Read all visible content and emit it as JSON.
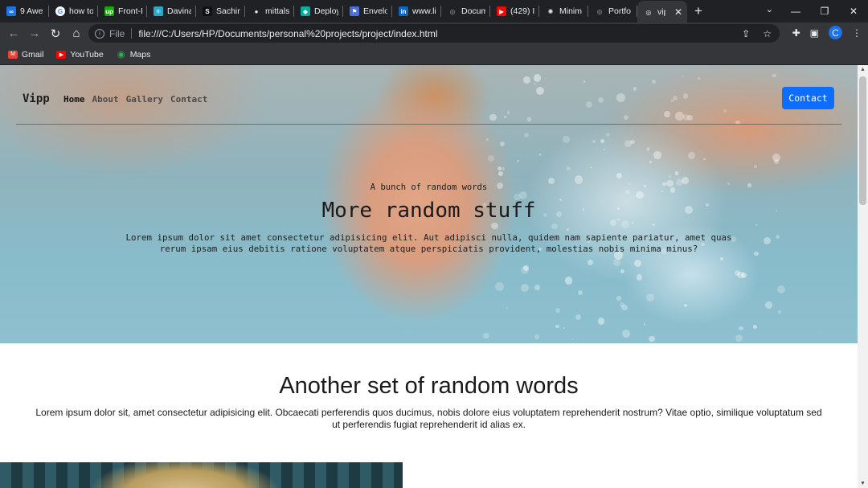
{
  "browser": {
    "tabs": [
      {
        "label": "9 Awe",
        "icon": "infinity-icon",
        "color": "#1a73e8",
        "glyph": "∞"
      },
      {
        "label": "how to",
        "icon": "google-icon",
        "color": "#ffffff",
        "glyph": "G"
      },
      {
        "label": "Front-I",
        "icon": "upwork-icon",
        "color": "#14a800",
        "glyph": "up"
      },
      {
        "label": "Davina",
        "icon": "react-icon",
        "color": "#2aa8c9",
        "glyph": "⚛"
      },
      {
        "label": "Sachin",
        "icon": "notion-icon",
        "color": "#111111",
        "glyph": "S"
      },
      {
        "label": "mittals",
        "icon": "github-icon",
        "color": "#e8eaed",
        "glyph": "●"
      },
      {
        "label": "Deploy",
        "icon": "diamond-icon",
        "color": "#00ad9f",
        "glyph": "◆"
      },
      {
        "label": "Envelo",
        "icon": "flag-icon",
        "color": "#4a6ee0",
        "glyph": "⚑"
      },
      {
        "label": "www.li",
        "icon": "linkedin-icon",
        "color": "#0a66c2",
        "glyph": "in"
      },
      {
        "label": "Docum",
        "icon": "globe-icon",
        "color": "#9aa0a6",
        "glyph": "◎"
      },
      {
        "label": "(429) I",
        "icon": "youtube-icon",
        "color": "#ff0000",
        "glyph": "▶"
      },
      {
        "label": "Minim",
        "icon": "openai-icon",
        "color": "#e8eaed",
        "glyph": "✺"
      },
      {
        "label": "Portfo",
        "icon": "globe-icon",
        "color": "#9aa0a6",
        "glyph": "◎"
      }
    ],
    "active_tab": {
      "label": "vip",
      "icon": "globe-icon",
      "close": "✕"
    },
    "new_tab": "+",
    "tab_search": "⌄",
    "window": {
      "minimize": "—",
      "restore": "❐",
      "close": "✕"
    },
    "toolbar": {
      "back": "←",
      "forward": "→",
      "reload": "↻",
      "home": "⌂",
      "info": "i",
      "scheme_label": "File",
      "url": "file:///C:/Users/HP/Documents/personal%20projects/project/index.html",
      "share": "⇪",
      "bookmark_star": "☆",
      "extensions": "✚",
      "sidepanel": "▣",
      "profile_initial": "C",
      "menu": "⋮"
    },
    "bookmarks": [
      {
        "label": "Gmail",
        "icon": "gmail-icon",
        "color": "#ea4335",
        "glyph": "M"
      },
      {
        "label": "YouTube",
        "icon": "youtube-icon",
        "color": "#ff0000",
        "glyph": "▶"
      },
      {
        "label": "Maps",
        "icon": "maps-icon",
        "color": "#34a853",
        "glyph": "◉"
      }
    ]
  },
  "page": {
    "nav": {
      "brand": "Vipp",
      "links": [
        "Home",
        "About",
        "Gallery",
        "Contact"
      ],
      "active_link": "Home",
      "contact_button": "Contact"
    },
    "hero": {
      "subtitle": "A bunch of random words",
      "title": "More random stuff",
      "text": "Lorem ipsum dolor sit amet consectetur adipisicing elit. Aut adipisci nulla, quidem nam sapiente pariatur, amet quas rerum ipsam eius debitis ratione voluptatem atque perspiciatis provident, molestias nobis minima minus?"
    },
    "section": {
      "title": "Another set of random words",
      "text": "Lorem ipsum dolor sit, amet consectetur adipisicing elit. Obcaecati perferendis quos ducimus, nobis dolore eius voluptatem reprehenderit nostrum? Vitae optio, similique voluptatum sed ut perferendis fugiat reprehenderit id alias ex."
    },
    "accent_color": "#0d6efd"
  }
}
